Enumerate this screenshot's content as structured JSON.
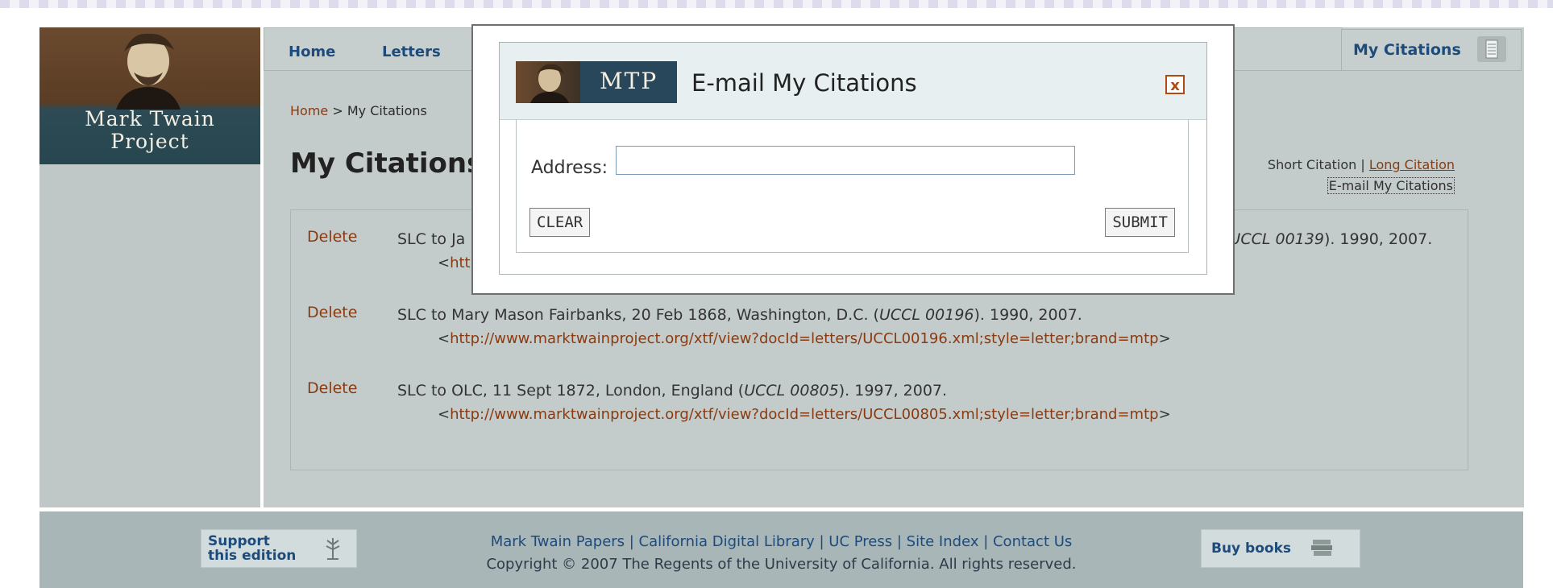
{
  "brand": {
    "logo_text_line1": "Mark Twain",
    "logo_text_line2": "Project"
  },
  "nav": {
    "items": [
      "Home",
      "Letters"
    ],
    "my_citations": "My Citations"
  },
  "breadcrumb": {
    "home": "Home",
    "sep": " > ",
    "current": "My Citations"
  },
  "page_title": "My Citations",
  "citation_options": {
    "short": "Short Citation",
    "sep": " | ",
    "long": "Long Citation",
    "email": "E-mail My Citations"
  },
  "citations": [
    {
      "delete": "Delete",
      "text_before": "SLC to Ja",
      "ref": "UCCL 00139",
      "text_after": "). 1990, 2007.",
      "url": "http"
    },
    {
      "delete": "Delete",
      "text_before": "SLC to Mary Mason Fairbanks, 20 Feb 1868, Washington, D.C. (",
      "ref": "UCCL 00196",
      "text_after": "). 1990, 2007.",
      "url": "http://www.marktwainproject.org/xtf/view?docId=letters/UCCL00196.xml;style=letter;brand=mtp"
    },
    {
      "delete": "Delete",
      "text_before": "SLC to OLC, 11 Sept 1872, London, England (",
      "ref": "UCCL 00805",
      "text_after": "). 1997, 2007.",
      "url": "http://www.marktwainproject.org/xtf/view?docId=letters/UCCL00805.xml;style=letter;brand=mtp"
    }
  ],
  "footer": {
    "support_line1": "Support",
    "support_line2": "this edition",
    "links": "Mark Twain Papers | California Digital Library | UC Press | Site Index | Contact Us",
    "copyright": "Copyright © 2007 The Regents of the University of California. All rights reserved.",
    "buy_books": "Buy books"
  },
  "modal": {
    "logo_text": "MTP",
    "title": "E-mail My Citations",
    "close": "x",
    "address_label": "Address:",
    "address_value": "",
    "clear": "CLEAR",
    "submit": "SUBMIT"
  }
}
